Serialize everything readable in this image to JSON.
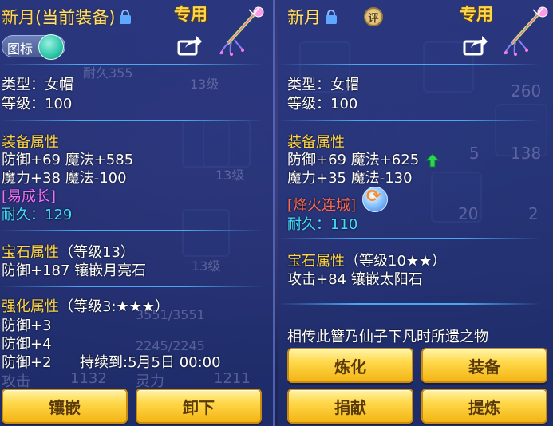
{
  "left": {
    "item_name": "新月",
    "paren_open": "(",
    "equip_status": "当前装备",
    "paren_close": ")",
    "exclusive_label": "专用",
    "icon_toggle_label": "图标",
    "type_line": "类型：女帽",
    "level_line": "等级：100",
    "equip_attr_heading": "装备属性",
    "stat_line_1": "防御+69 魔法+585",
    "stat_line_2": "魔力+38 魔法-100",
    "special_tag": "[易成长]",
    "durability_label": "耐久：",
    "durability_value": "129",
    "gem_heading": "宝石属性",
    "gem_level": "（等级13）",
    "gem_line": "防御+187 镶嵌月亮石",
    "enhance_heading": "强化属性",
    "enhance_level": "（等级3:★★★）",
    "enhance_line_1": "防御+3",
    "enhance_line_2": "防御+4",
    "enhance_line_3": "防御+2",
    "duration_text": "持续到:5月5日 00:00",
    "button_inlay": "镶嵌",
    "button_unequip": "卸下",
    "bg_hp": "3551/3551",
    "bg_mp": "2245/2245",
    "bg_attack": "攻击",
    "bg_attack_val": "1132",
    "bg_spirit": "灵力",
    "bg_spirit_val": "1211",
    "bg_durability": "耐久355",
    "bg_level_1": "13级",
    "bg_level_2": "13级",
    "bg_level_3": "13级"
  },
  "right": {
    "item_name": "新月",
    "rate_badge": "评",
    "exclusive_label": "专用",
    "type_line": "类型：女帽",
    "level_line": "等级：100",
    "equip_attr_heading": "装备属性",
    "stat_line_1": "防御+69 魔法+625",
    "stat_line_2": "魔力+35 魔法-130",
    "special_tag": "[烽火连城]",
    "durability_label": "耐久：",
    "durability_value": "110",
    "gem_heading": "宝石属性",
    "gem_level": "（等级10★★）",
    "gem_line": "攻击+84 镶嵌太阳石",
    "lore_text": "相传此簪乃仙子下凡时所遗之物",
    "button_refine": "炼化",
    "button_equip": "装备",
    "button_donate": "捐献",
    "button_extract": "提炼",
    "bg_count_1": "260",
    "bg_count_2": "5",
    "bg_count_3": "138",
    "bg_count_4": "20",
    "bg_count_5": "2"
  },
  "icons": {
    "lock": "lock-icon",
    "share": "share-icon",
    "wand": "wand-icon",
    "upgrade_arrow": "up-arrow-icon",
    "refresh": "refresh-icon"
  },
  "colors": {
    "name_gold": "#ffd45a",
    "heading_yellow": "#ffd54a",
    "durability_cyan": "#3fe0ff",
    "special_pink": "#f070ff",
    "special_red": "#ff6a55",
    "upgrade_green": "#2fd35a"
  }
}
